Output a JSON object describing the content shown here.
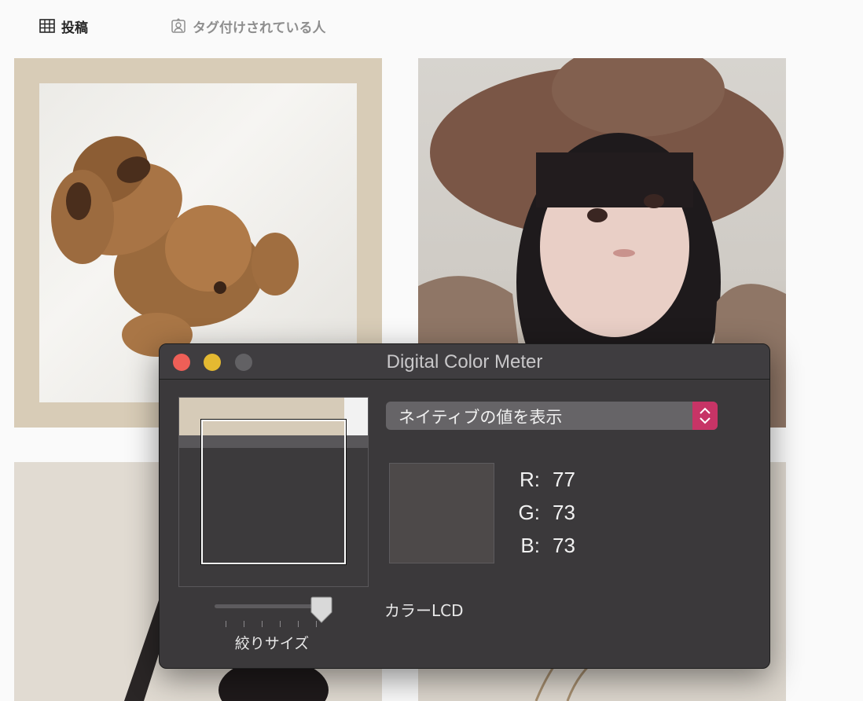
{
  "tabs": {
    "posts_label": "投稿",
    "tagged_label": "タグ付けされている人"
  },
  "grid": {
    "items": [
      "teddy-bear-photo",
      "hat-portrait-photo",
      "guitar-photo",
      "flowers-photo"
    ]
  },
  "window": {
    "title": "Digital Color Meter",
    "display_mode": "ネイティブの値を表示",
    "color": {
      "r_label": "R:",
      "r": "77",
      "g_label": "G:",
      "g": "73",
      "b_label": "B:",
      "b": "73"
    },
    "swatch_color": "#4d4949",
    "aperture_label": "絞りサイズ",
    "aperture_level": 1.0,
    "display_profile": "カラーLCD"
  },
  "colors": {
    "close": "#ee5f57",
    "minimize": "#e4b931",
    "zoom_inactive": "#626164",
    "popup_accent": "#c73466"
  }
}
